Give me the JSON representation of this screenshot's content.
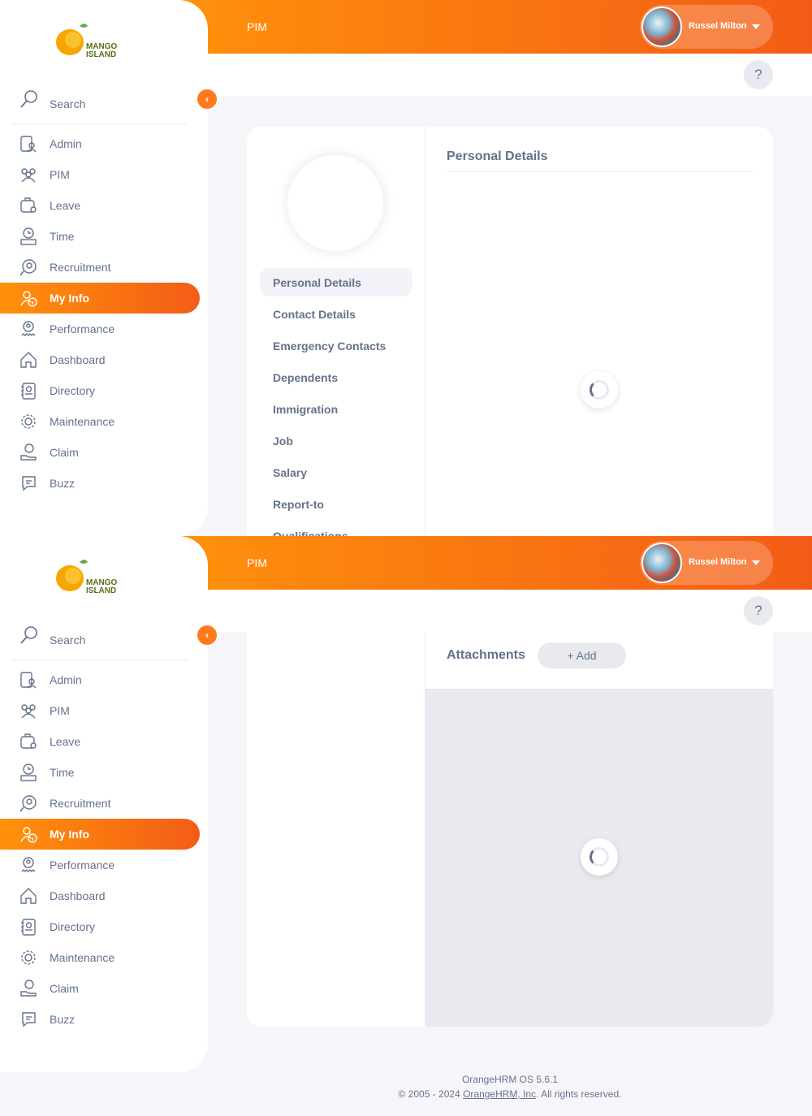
{
  "app": {
    "logo_top": "MANGO",
    "logo_bottom": "ISLAND",
    "module_title": "PIM",
    "user_name": "Russel Milton",
    "help_label": "?"
  },
  "sidebar": {
    "search_label": "Search",
    "items": [
      {
        "label": "Admin",
        "icon": "admin-icon"
      },
      {
        "label": "PIM",
        "icon": "pim-icon"
      },
      {
        "label": "Leave",
        "icon": "leave-icon"
      },
      {
        "label": "Time",
        "icon": "time-icon"
      },
      {
        "label": "Recruitment",
        "icon": "recruitment-icon"
      },
      {
        "label": "My Info",
        "icon": "my-info-icon",
        "active": true
      },
      {
        "label": "Performance",
        "icon": "performance-icon"
      },
      {
        "label": "Dashboard",
        "icon": "dashboard-icon"
      },
      {
        "label": "Directory",
        "icon": "directory-icon"
      },
      {
        "label": "Maintenance",
        "icon": "maintenance-icon"
      },
      {
        "label": "Claim",
        "icon": "claim-icon"
      },
      {
        "label": "Buzz",
        "icon": "buzz-icon"
      }
    ]
  },
  "profile_tabs": [
    {
      "label": "Personal Details",
      "active": true
    },
    {
      "label": "Contact Details"
    },
    {
      "label": "Emergency Contacts"
    },
    {
      "label": "Dependents"
    },
    {
      "label": "Immigration"
    },
    {
      "label": "Job"
    },
    {
      "label": "Salary"
    },
    {
      "label": "Report-to"
    },
    {
      "label": "Qualifications"
    }
  ],
  "main": {
    "section_title": "Personal Details",
    "attachments_title": "Attachments",
    "add_label": "+ Add"
  },
  "footer": {
    "version": "OrangeHRM OS 5.6.1",
    "copyright_prefix": "© 2005 - 2024 ",
    "company_link": "OrangeHRM, Inc",
    "copyright_suffix": ". All rights reserved."
  },
  "colors": {
    "accent": "#ff7b1d",
    "topbar_start": "#ff920b",
    "topbar_end": "#f35c17",
    "text": "#64728c"
  }
}
